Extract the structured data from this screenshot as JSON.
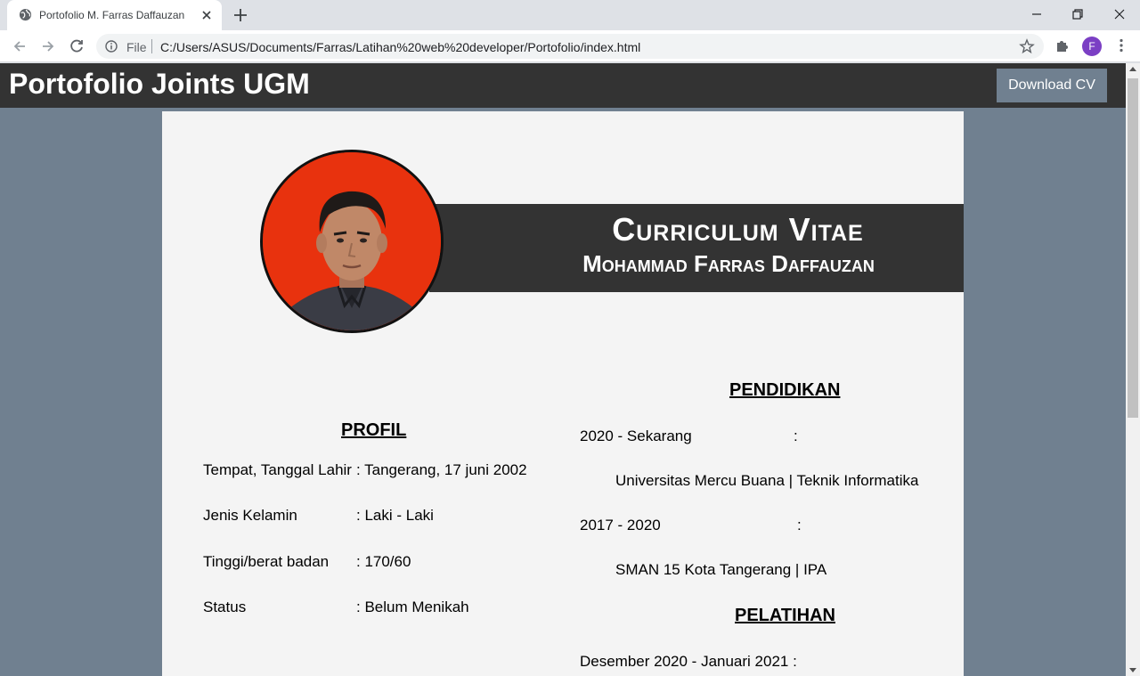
{
  "browser": {
    "tab_title": "Portofolio M. Farras Daffauzan",
    "omnibox_scheme": "File",
    "url": "C:/Users/ASUS/Documents/Farras/Latihan%20web%20developer/Portofolio/index.html",
    "avatar_letter": "F"
  },
  "header": {
    "title": "Portofolio Joints UGM",
    "cv_button": "Download CV"
  },
  "banner": {
    "title": "Curriculum Vitae",
    "name": "Mohammad Farras Daffauzan"
  },
  "profil": {
    "heading": "PROFIL",
    "rows": [
      {
        "label": "Tempat, Tanggal Lahir",
        "value": ": Tangerang, 17 juni 2002"
      },
      {
        "label": "Jenis Kelamin",
        "value": ": Laki - Laki"
      },
      {
        "label": "Tinggi/berat badan",
        "value": ": 170/60"
      },
      {
        "label": "Status",
        "value": ": Belum Menikah"
      }
    ]
  },
  "pendidikan": {
    "heading": "PENDIDIKAN",
    "items": [
      {
        "period": "2020 - Sekarang",
        "colon": ":",
        "school": "Universitas Mercu Buana | Teknik Informatika"
      },
      {
        "period": "2017 - 2020",
        "colon": ":",
        "school": "SMAN 15 Kota Tangerang | IPA"
      }
    ]
  },
  "pelatihan": {
    "heading": "PELATIHAN",
    "items": [
      {
        "period": "Desember 2020 - Januari 2021 :"
      }
    ]
  },
  "colors": {
    "page_bg": "#708090",
    "header_bg": "#333333",
    "card_bg": "#f4f4f4",
    "photo_bg": "#e8320e"
  }
}
